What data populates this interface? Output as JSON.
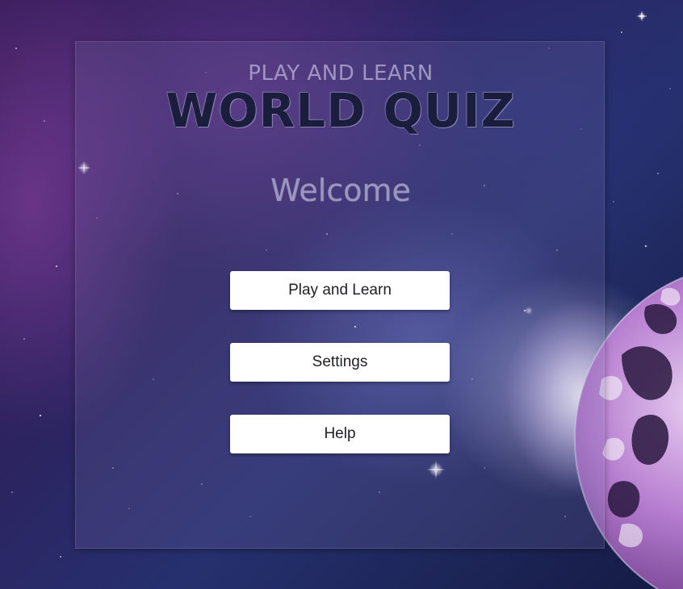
{
  "header": {
    "subtitle": "PLAY AND LEARN",
    "title": "WORLD QUIZ"
  },
  "welcome_text": "Welcome",
  "menu": {
    "play_label": "Play and Learn",
    "settings_label": "Settings",
    "help_label": "Help"
  },
  "colors": {
    "panel_tint": "#786eaa",
    "title_text": "#1b1d3c",
    "button_bg": "#ffffff",
    "button_text": "#202124",
    "planet_purple": "#a65fc4"
  },
  "background": {
    "theme": "space-nebula",
    "decoration": "planet-earth-icon"
  }
}
